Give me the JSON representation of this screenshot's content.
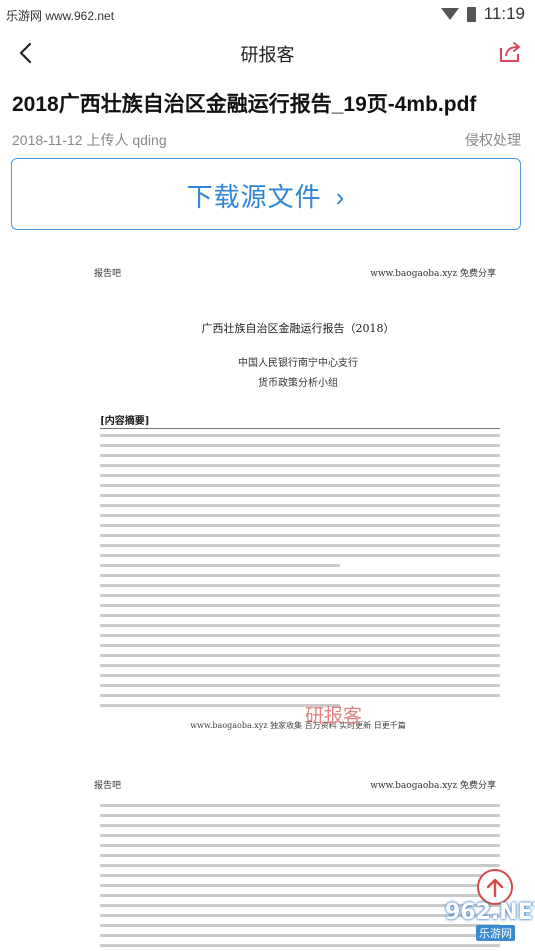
{
  "status_bar": {
    "watermark": "乐游网 www.962.net",
    "time": "11:19"
  },
  "top_bar": {
    "title": "研报客"
  },
  "document": {
    "title": "2018广西壮族自治区金融运行报告_19页-4mb.pdf",
    "meta": "2018-11-12 上传人 qding",
    "report_link": "侵权处理",
    "download_label": "下载源文件",
    "download_chevron": "›"
  },
  "preview": {
    "page1": {
      "header_left": "报告吧",
      "header_right": "www.baogaoba.xyz  免费分享",
      "title": "广西壮族自治区金融运行报告（2018）",
      "org": "中国人民银行南宁中心支行",
      "group": "货币政策分析小组",
      "abstract_heading": "[内容摘要]",
      "footer": "www.baogaoba.xyz  独家收集  百万资料  实时更新  日更千篇"
    },
    "page2": {
      "header_left": "报告吧",
      "header_right": "www.baogaoba.xyz  免费分享"
    },
    "watermark": "研报客"
  },
  "brand": {
    "logo_text": "962.NET",
    "logo_sub": "乐游网"
  },
  "colors": {
    "accent_blue": "#2f86d6",
    "share_red": "#e0445a",
    "scroll_red": "#d84848"
  },
  "icons": [
    "back-arrow-icon",
    "share-icon",
    "wifi-icon",
    "battery-icon",
    "chevron-right-icon",
    "arrow-up-icon"
  ]
}
